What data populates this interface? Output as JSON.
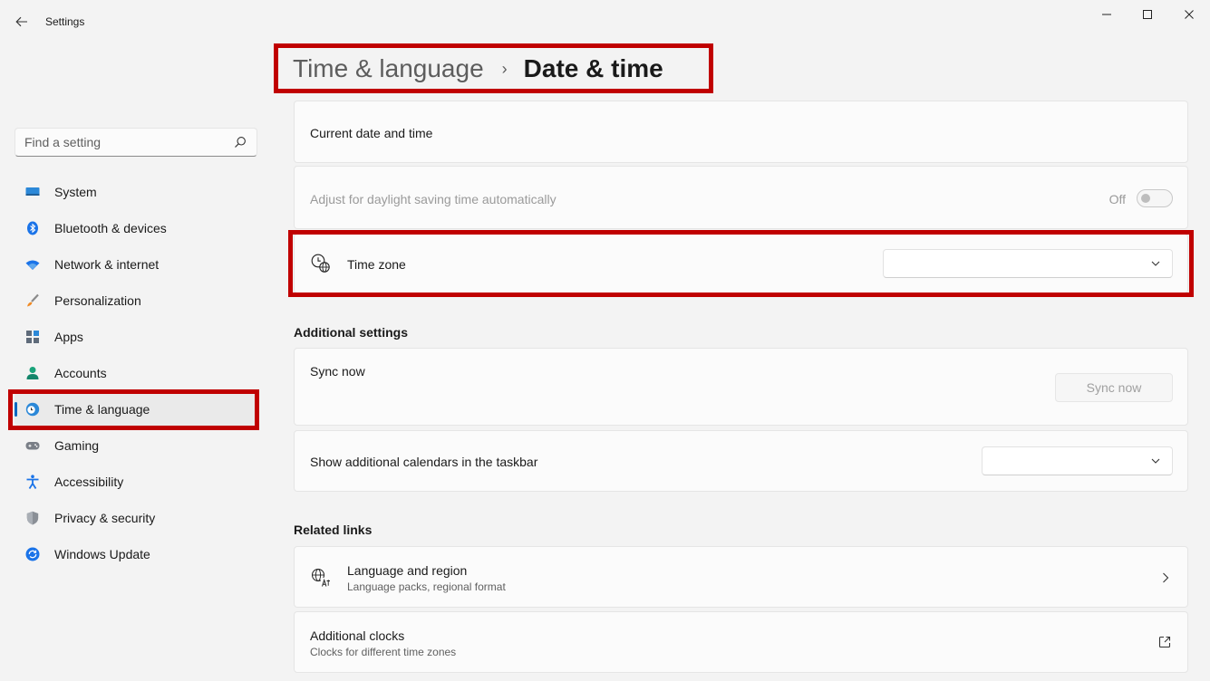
{
  "window": {
    "title": "Settings",
    "icons": {
      "back": "back-arrow-icon",
      "minimize": "minimize-icon",
      "maximize": "maximize-icon",
      "close": "close-icon"
    }
  },
  "search": {
    "placeholder": "Find a setting",
    "icon": "search-icon"
  },
  "sidebar": {
    "items": [
      {
        "label": "System",
        "icon": "monitor-icon"
      },
      {
        "label": "Bluetooth & devices",
        "icon": "bluetooth-icon"
      },
      {
        "label": "Network & internet",
        "icon": "wifi-icon"
      },
      {
        "label": "Personalization",
        "icon": "paintbrush-icon"
      },
      {
        "label": "Apps",
        "icon": "apps-icon"
      },
      {
        "label": "Accounts",
        "icon": "person-icon"
      },
      {
        "label": "Time & language",
        "icon": "globe-clock-icon",
        "selected": true
      },
      {
        "label": "Gaming",
        "icon": "gamepad-icon"
      },
      {
        "label": "Accessibility",
        "icon": "accessibility-icon"
      },
      {
        "label": "Privacy & security",
        "icon": "shield-icon"
      },
      {
        "label": "Windows Update",
        "icon": "update-icon"
      }
    ]
  },
  "breadcrumb": {
    "parent": "Time & language",
    "separator": "›",
    "current": "Date & time"
  },
  "main": {
    "current_date_time": {
      "label": "Current date and time"
    },
    "dst": {
      "label": "Adjust for daylight saving time automatically",
      "state_label": "Off",
      "enabled": false
    },
    "time_zone": {
      "label": "Time zone",
      "icon": "clock-globe-icon",
      "value": ""
    },
    "additional_settings": {
      "title": "Additional settings",
      "sync": {
        "label": "Sync now",
        "button_label": "Sync now"
      },
      "calendars": {
        "label": "Show additional calendars in the taskbar",
        "value": ""
      }
    },
    "related_links": {
      "title": "Related links",
      "language_region": {
        "label": "Language and region",
        "sublabel": "Language packs, regional format",
        "icon": "language-icon"
      },
      "additional_clocks": {
        "label": "Additional clocks",
        "sublabel": "Clocks for different time zones",
        "icon": "open-external-icon"
      }
    }
  },
  "colors": {
    "highlight_box": "#c00000",
    "accent": "#0067c0",
    "background": "#f3f3f3",
    "card": "#fbfbfb"
  }
}
